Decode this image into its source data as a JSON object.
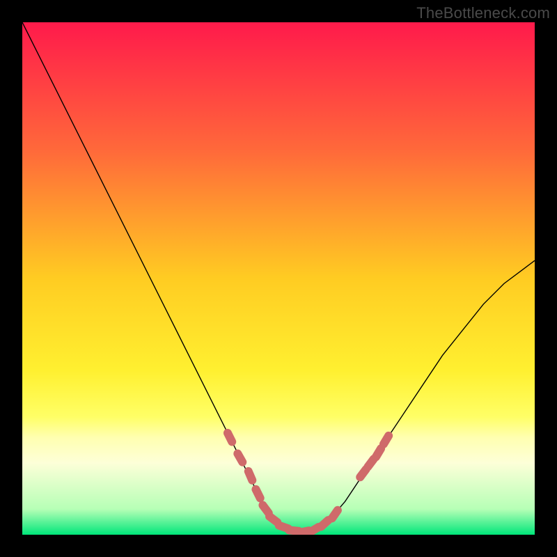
{
  "watermark": "TheBottleneck.com",
  "chart_data": {
    "type": "line",
    "title": "",
    "xlabel": "",
    "ylabel": "",
    "xlim": [
      0,
      100
    ],
    "ylim": [
      0,
      100
    ],
    "grid": false,
    "legend": false,
    "background_gradient": {
      "stops": [
        {
          "offset": 0.0,
          "color": "#ff1a4b"
        },
        {
          "offset": 0.25,
          "color": "#ff693a"
        },
        {
          "offset": 0.5,
          "color": "#ffcc22"
        },
        {
          "offset": 0.68,
          "color": "#fff030"
        },
        {
          "offset": 0.77,
          "color": "#ffff66"
        },
        {
          "offset": 0.81,
          "color": "#ffffb0"
        },
        {
          "offset": 0.86,
          "color": "#fdffd8"
        },
        {
          "offset": 0.95,
          "color": "#b6ffb6"
        },
        {
          "offset": 1.0,
          "color": "#00e67a"
        }
      ]
    },
    "series": [
      {
        "name": "bottleneck-curve",
        "color": "#000000",
        "width": 1.4,
        "x": [
          0.0,
          4.0,
          8.0,
          12.0,
          16.0,
          20.0,
          24.0,
          28.0,
          32.0,
          36.0,
          40.0,
          44.0,
          46.5,
          49.0,
          51.5,
          54.5,
          57.0,
          60.0,
          63.0,
          66.0,
          70.0,
          74.0,
          78.0,
          82.0,
          86.0,
          90.0,
          94.0,
          98.0,
          100.0
        ],
        "y": [
          100.0,
          92.0,
          84.0,
          76.0,
          68.0,
          60.0,
          52.0,
          44.0,
          36.0,
          28.0,
          20.0,
          12.0,
          7.0,
          3.0,
          1.0,
          0.5,
          1.0,
          3.0,
          6.5,
          11.0,
          17.0,
          23.0,
          29.0,
          35.0,
          40.0,
          45.0,
          49.0,
          52.0,
          53.5
        ]
      }
    ],
    "markers": {
      "name": "highlight-dots",
      "color": "#cf6a6a",
      "radius": 6,
      "x": [
        40.5,
        42.5,
        44.5,
        46.0,
        47.5,
        49.0,
        51.0,
        53.0,
        55.0,
        57.0,
        59.0,
        61.0,
        66.5,
        68.0,
        69.5,
        71.0
      ],
      "y": [
        19.0,
        15.0,
        11.5,
        8.0,
        5.0,
        3.0,
        1.5,
        0.8,
        0.6,
        1.0,
        2.2,
        4.0,
        12.0,
        14.0,
        16.0,
        18.5
      ]
    }
  }
}
